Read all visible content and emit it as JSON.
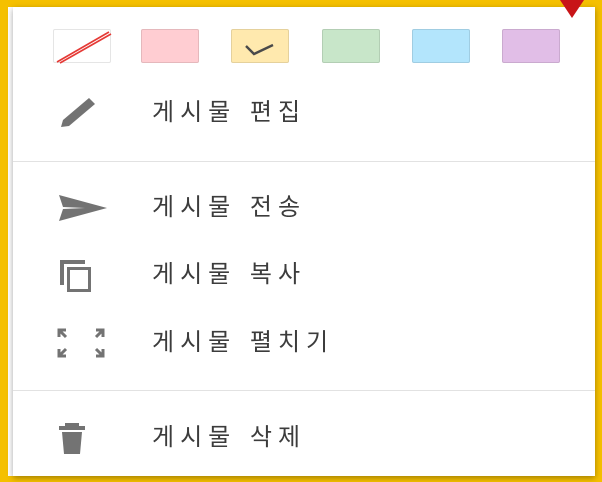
{
  "colors": {
    "accent_frame": "#f5c000",
    "icon_gray": "#737373",
    "swatch_none": "#ffffff",
    "swatch_red": "#ffcdd2",
    "swatch_yellow": "#ffe9ae",
    "swatch_green": "#c8e6c9",
    "swatch_blue": "#b3e5fc",
    "swatch_purple": "#e1bee7",
    "no_color_slash": "#e53935",
    "corner_marker": "#c81418"
  },
  "swatches": [
    {
      "name": "no-color",
      "selected": false
    },
    {
      "name": "red",
      "selected": false
    },
    {
      "name": "yellow",
      "selected": true
    },
    {
      "name": "green",
      "selected": false
    },
    {
      "name": "blue",
      "selected": false
    },
    {
      "name": "purple",
      "selected": false
    }
  ],
  "menu": {
    "edit": {
      "label": "게시물 편집",
      "icon": "pencil-icon"
    },
    "send": {
      "label": "게시물 전송",
      "icon": "send-icon"
    },
    "copy": {
      "label": "게시물 복사",
      "icon": "copy-icon"
    },
    "expand": {
      "label": "게시물 펼치기",
      "icon": "expand-icon"
    },
    "delete": {
      "label": "게시물 삭제",
      "icon": "trash-icon"
    }
  }
}
